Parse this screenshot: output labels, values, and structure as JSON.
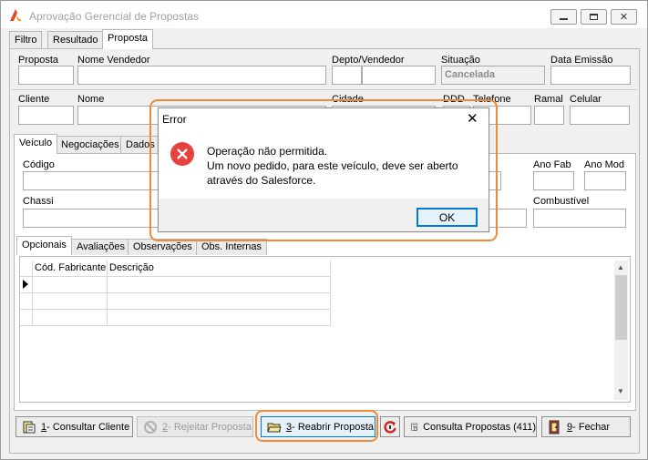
{
  "window": {
    "title": "Aprovação Gerencial de Propostas"
  },
  "top_tabs": [
    "Filtro",
    "Resultado",
    "Proposta"
  ],
  "header": {
    "proposta_label": "Proposta",
    "nome_vendedor_label": "Nome Vendedor",
    "depto_vendedor_label": "Depto/Vendedor",
    "situacao_label": "Situação",
    "situacao_value": "Cancelada",
    "data_emissao_label": "Data Emissão",
    "cliente_label": "Cliente",
    "nome_label": "Nome",
    "cidade_label": "Cidade",
    "ddd_label": "DDD",
    "telefone_label": "Telefone",
    "ramal_label": "Ramal",
    "celular_label": "Celular"
  },
  "vehicle_tabs": [
    "Veículo",
    "Negociações",
    "Dados c"
  ],
  "vehicle": {
    "codigo_label": "Código",
    "ano_fab_label": "Ano Fab",
    "ano_mod_label": "Ano Mod",
    "chassi_label": "Chassi",
    "combustivel_label": "Combustível"
  },
  "sub_tabs": [
    "Opcionais",
    "Avaliações",
    "Observações",
    "Obs. Internas"
  ],
  "grid": {
    "columns": [
      "Cód. Fabricante",
      "Descrição"
    ]
  },
  "buttons": {
    "consultar_num": "1",
    "consultar_text": " - Consultar Cliente",
    "rejeitar_num": "2",
    "rejeitar_text": " - Rejeitar Proposta",
    "reabrir_num": "3",
    "reabrir_text": " - Reabrir Proposta",
    "consulta_propostas": "Consulta Propostas (411)",
    "fechar_num": "9",
    "fechar_text": " - Fechar"
  },
  "dialog": {
    "title": "Error",
    "line1": "Operação não permitida.",
    "line2": "Um novo pedido, para este veículo, deve ser aberto",
    "line3": "através do Salesforce.",
    "ok_label": "OK"
  },
  "colors": {
    "highlight": "#ee8a3a",
    "error_red": "#e8413c",
    "accent_blue": "#0078d7"
  },
  "icons": [
    "app-logo-icon",
    "minimize-icon",
    "maximize-icon",
    "close-icon",
    "error-icon",
    "consultar-icon",
    "rejeitar-icon",
    "folder-open-icon",
    "refresh-icon",
    "consulta-icon",
    "fechar-icon"
  ]
}
